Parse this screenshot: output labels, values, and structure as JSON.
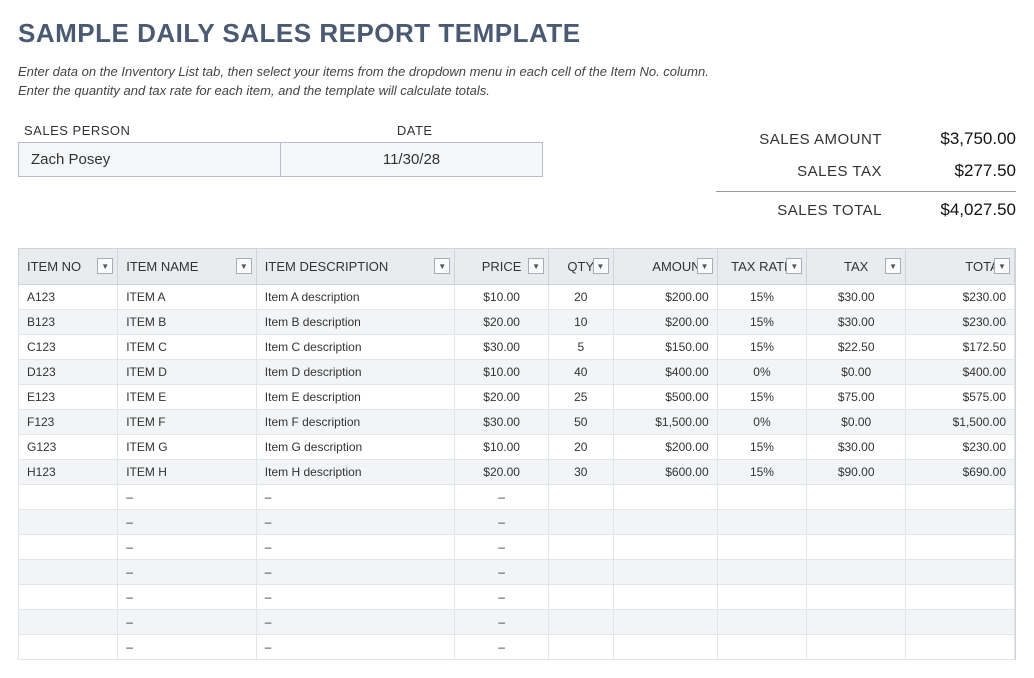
{
  "title": "SAMPLE DAILY SALES REPORT TEMPLATE",
  "instructions_line1": "Enter data on the Inventory List tab, then select your items from the dropdown menu in each cell of the Item No. column.",
  "instructions_line2": "Enter the quantity and tax rate for each item, and the template will calculate totals.",
  "meta": {
    "sales_person_label": "SALES PERSON",
    "date_label": "DATE",
    "sales_person": "Zach Posey",
    "date": "11/30/28"
  },
  "summary": {
    "amount_label": "SALES AMOUNT",
    "amount_value": "$3,750.00",
    "tax_label": "SALES TAX",
    "tax_value": "$277.50",
    "total_label": "SALES TOTAL",
    "total_value": "$4,027.50"
  },
  "columns": {
    "item_no": "ITEM NO",
    "item_name": "ITEM NAME",
    "item_desc": "ITEM DESCRIPTION",
    "price": "PRICE",
    "qty": "QTY",
    "amount": "AMOUNT",
    "tax_rate": "TAX RATE",
    "tax": "TAX",
    "total": "TOTAL"
  },
  "rows": [
    {
      "no": "A123",
      "name": "ITEM A",
      "desc": "Item A description",
      "price": "$10.00",
      "qty": "20",
      "amount": "$200.00",
      "rate": "15%",
      "tax": "$30.00",
      "total": "$230.00"
    },
    {
      "no": "B123",
      "name": "ITEM B",
      "desc": "Item B description",
      "price": "$20.00",
      "qty": "10",
      "amount": "$200.00",
      "rate": "15%",
      "tax": "$30.00",
      "total": "$230.00"
    },
    {
      "no": "C123",
      "name": "ITEM C",
      "desc": "Item C description",
      "price": "$30.00",
      "qty": "5",
      "amount": "$150.00",
      "rate": "15%",
      "tax": "$22.50",
      "total": "$172.50"
    },
    {
      "no": "D123",
      "name": "ITEM D",
      "desc": "Item D description",
      "price": "$10.00",
      "qty": "40",
      "amount": "$400.00",
      "rate": "0%",
      "tax": "$0.00",
      "total": "$400.00"
    },
    {
      "no": "E123",
      "name": "ITEM E",
      "desc": "Item E description",
      "price": "$20.00",
      "qty": "25",
      "amount": "$500.00",
      "rate": "15%",
      "tax": "$75.00",
      "total": "$575.00"
    },
    {
      "no": "F123",
      "name": "ITEM F",
      "desc": "Item F description",
      "price": "$30.00",
      "qty": "50",
      "amount": "$1,500.00",
      "rate": "0%",
      "tax": "$0.00",
      "total": "$1,500.00"
    },
    {
      "no": "G123",
      "name": "ITEM G",
      "desc": "Item G description",
      "price": "$10.00",
      "qty": "20",
      "amount": "$200.00",
      "rate": "15%",
      "tax": "$30.00",
      "total": "$230.00"
    },
    {
      "no": "H123",
      "name": "ITEM H",
      "desc": "Item H description",
      "price": "$20.00",
      "qty": "30",
      "amount": "$600.00",
      "rate": "15%",
      "tax": "$90.00",
      "total": "$690.00"
    }
  ],
  "empty_row_count": 7,
  "dash": "–",
  "filter_glyph": "▼"
}
